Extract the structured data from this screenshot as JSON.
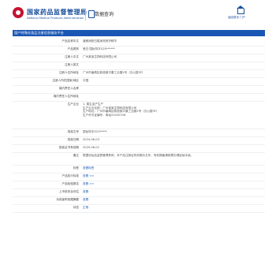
{
  "header": {
    "site_title": "国家药品监督管理局",
    "site_subtitle": "National Medical Products Administration",
    "db_title": "数据查询",
    "home_label": "返回首页 门户"
  },
  "section_title": "国产特殊化妆品注册信息服务平台",
  "rows": [
    {
      "label": "产品名称中文",
      "value": "薇雅润肤白皙焕亮修护精华"
    },
    {
      "label": "产品类别",
      "value": "美白 国妆特字G20******"
    },
    {
      "label": "注册人中文",
      "value": "广州某某生物科技有限公司"
    },
    {
      "label": "注册人英文",
      "value": ""
    },
    {
      "label": "注册人住所地址",
      "value": "广州市番禺区新造镇平康工业路2号（办公楼3F）"
    },
    {
      "label": "注册人所在国家/地区",
      "value": "中国"
    },
    {
      "label": "境内责任人名称",
      "value": ""
    },
    {
      "label": "境内责任人住所地址",
      "value": ""
    },
    {
      "label": "生产企业",
      "lines": [
        "1. 属生品产生产",
        "生产企业名称：广州某某生物科技有限公司",
        "生产地址：广州市番禺区新造镇平康工业路2号（办公楼3F）",
        "生产许可证编号：粤妆20200706"
      ]
    },
    {
      "label": "批准文号",
      "value": "国妆特字G20*****"
    },
    {
      "label": "批准日期",
      "value": "2024-06-03"
    },
    {
      "label": "批准证书有效期",
      "value": "2029-06-02"
    },
    {
      "label": "备注",
      "value": "根据化妆品监督管理条例，本产品注册证有效期为五年，有效期届满前需办理延续手续。"
    },
    {
      "label": "标签",
      "value": "查看标签",
      "link": true
    },
    {
      "label": "产品执行标准",
      "value": "查看 >>",
      "link": true
    },
    {
      "label": "产品检验报告",
      "value": "查看 >>",
      "link": true
    },
    {
      "label": "上市前安全评估",
      "value": "查看",
      "link": true
    },
    {
      "label": "功效宣称依据摘要",
      "value": "查看",
      "link": true
    },
    {
      "label": "状态",
      "value": "正常",
      "link": true
    }
  ],
  "colors": {
    "brand": "#1a4f9c",
    "bar": "#1a56b3",
    "logo": "#c8102e"
  }
}
